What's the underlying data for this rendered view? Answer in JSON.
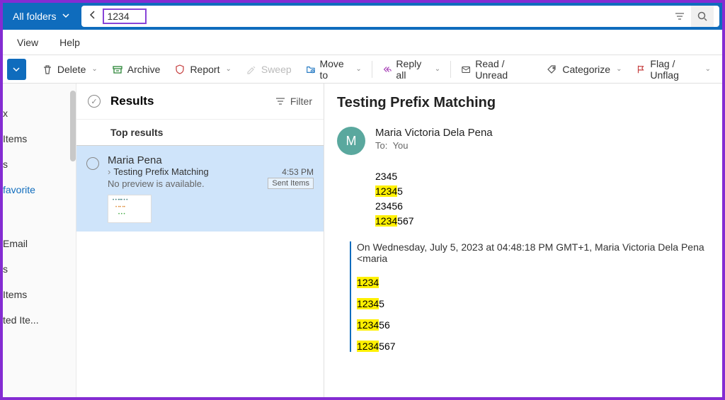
{
  "search": {
    "folder_select": "All folders",
    "query": "1234"
  },
  "menu": {
    "view": "View",
    "help": "Help"
  },
  "toolbar": {
    "delete": "Delete",
    "archive": "Archive",
    "report": "Report",
    "sweep": "Sweep",
    "move_to": "Move to",
    "reply_all": "Reply all",
    "read_unread": "Read / Unread",
    "categorize": "Categorize",
    "flag_unflag": "Flag / Unflag"
  },
  "sidebar": {
    "items": [
      "x",
      "Items",
      "s",
      "favorite",
      "Email",
      "s",
      "Items",
      "ted Ite..."
    ]
  },
  "list": {
    "title": "Results",
    "filter": "Filter",
    "section": "Top results",
    "message": {
      "from": "Maria Pena",
      "subject": "Testing Prefix Matching",
      "time": "4:53 PM",
      "preview": "No preview is available.",
      "badge": "Sent Items"
    }
  },
  "mail": {
    "subject": "Testing Prefix Matching",
    "avatar_initial": "M",
    "sender": "Maria Victoria Dela Pena",
    "to_label": "To:",
    "to_value": "You",
    "body_lines": [
      {
        "unhl_pre": "2345",
        "hl": "",
        "unhl_post": ""
      },
      {
        "unhl_pre": "",
        "hl": "1234",
        "unhl_post": "5"
      },
      {
        "unhl_pre": "23456",
        "hl": "",
        "unhl_post": ""
      },
      {
        "unhl_pre": "",
        "hl": "1234",
        "unhl_post": "567"
      }
    ],
    "quote_header": "On Wednesday, July 5, 2023 at 04:48:18 PM GMT+1, Maria Victoria Dela Pena <maria",
    "quote_lines": [
      {
        "hl": "1234",
        "rest": ""
      },
      {
        "hl": "1234",
        "rest": "5"
      },
      {
        "hl": "1234",
        "rest": "56"
      },
      {
        "hl": "1234",
        "rest": "567"
      }
    ]
  }
}
